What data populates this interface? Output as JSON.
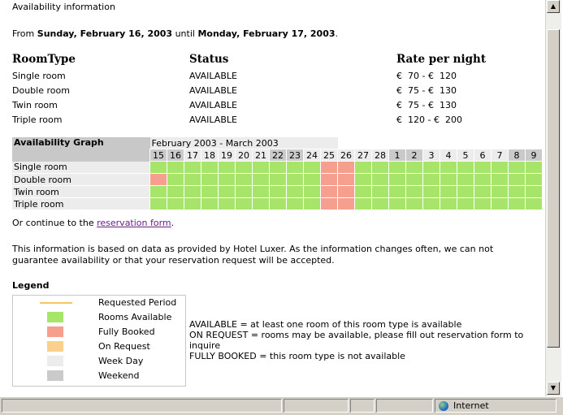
{
  "page": {
    "heading": "Availability information",
    "from_label": "From",
    "from_date": "Sunday, February 16, 2003",
    "until_label": "until",
    "until_date": "Monday, February 17, 2003",
    "period_end": "."
  },
  "rooms_table": {
    "headers": [
      "RoomType",
      "Status",
      "Rate per night"
    ],
    "rows": [
      {
        "type": "Single room",
        "status": "AVAILABLE",
        "rate": "€  70 - €  120"
      },
      {
        "type": "Double room",
        "status": "AVAILABLE",
        "rate": "€  75 - €  130"
      },
      {
        "type": "Twin room",
        "status": "AVAILABLE",
        "rate": "€  75 - €  130"
      },
      {
        "type": "Triple room",
        "status": "AVAILABLE",
        "rate": "€  120 - €  200"
      }
    ]
  },
  "graph": {
    "title": "Availability Graph",
    "months": "February 2003  -  March 2003",
    "days": [
      {
        "d": "15",
        "kind": "weekend"
      },
      {
        "d": "16",
        "kind": "weekend"
      },
      {
        "d": "17",
        "kind": "weekday"
      },
      {
        "d": "18",
        "kind": "weekday"
      },
      {
        "d": "19",
        "kind": "weekday"
      },
      {
        "d": "20",
        "kind": "weekday"
      },
      {
        "d": "21",
        "kind": "weekday"
      },
      {
        "d": "22",
        "kind": "weekend"
      },
      {
        "d": "23",
        "kind": "weekend"
      },
      {
        "d": "24",
        "kind": "weekday"
      },
      {
        "d": "25",
        "kind": "weekday"
      },
      {
        "d": "26",
        "kind": "weekday"
      },
      {
        "d": "27",
        "kind": "weekday"
      },
      {
        "d": "28",
        "kind": "weekday"
      },
      {
        "d": "1",
        "kind": "weekend"
      },
      {
        "d": "2",
        "kind": "weekend"
      },
      {
        "d": "3",
        "kind": "weekday"
      },
      {
        "d": "4",
        "kind": "weekday"
      },
      {
        "d": "5",
        "kind": "weekday"
      },
      {
        "d": "6",
        "kind": "weekday"
      },
      {
        "d": "7",
        "kind": "weekday"
      },
      {
        "d": "8",
        "kind": "weekend"
      },
      {
        "d": "9",
        "kind": "weekend"
      }
    ],
    "rows": [
      {
        "room": "Single room",
        "cells": "AAAAAAAAAAFFAAAAAAAAAAA"
      },
      {
        "room": "Double room",
        "cells": "FAAAAAAAAAFFAAAAAAAAAAA"
      },
      {
        "room": "Twin room",
        "cells": "AAAAAAAAAAFFAAAAAAAAAAA"
      },
      {
        "room": "Triple room",
        "cells": "AAAAAAAAAAFFAAAAAAAAAAA"
      }
    ]
  },
  "continue": {
    "prefix": "Or continue to the",
    "link": "reservation form",
    "suffix": "."
  },
  "info_text_line1": "This information is based on data as provided by Hotel Luxer. As the information changes often, we can not",
  "info_text_line2": "guarantee availability or that your reservation request will be accepted.",
  "legend": {
    "title": "Legend",
    "items": [
      {
        "label": "Requested Period",
        "swatch": "line",
        "color": "#f5c36a"
      },
      {
        "label": "Rooms Available",
        "swatch": "box",
        "color": "#a6e46a"
      },
      {
        "label": "Fully Booked",
        "swatch": "box",
        "color": "#f79f8f"
      },
      {
        "label": "On Request",
        "swatch": "box",
        "color": "#fbd08c"
      },
      {
        "label": "Week Day",
        "swatch": "box",
        "color": "#ececec"
      },
      {
        "label": "Weekend",
        "swatch": "box",
        "color": "#cacaca"
      }
    ],
    "notes": [
      "AVAILABLE = at least one room of this room type is available",
      "ON REQUEST = rooms may be available, please fill out reservation form to",
      "inquire",
      "FULLY BOOKED = this room type is not available"
    ]
  },
  "statusbar": {
    "zone_icon": "globe-icon",
    "zone": "Internet"
  },
  "scrollbar": {
    "up_icon": "scroll-up-arrow-icon",
    "down_icon": "scroll-down-arrow-icon"
  }
}
